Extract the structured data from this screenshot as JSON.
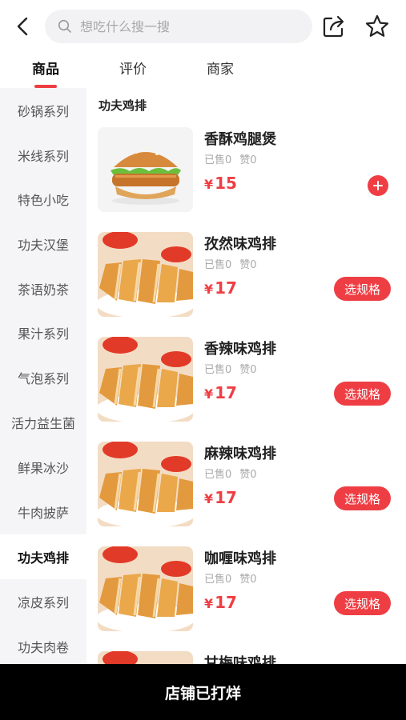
{
  "search": {
    "placeholder": "想吃什么搜一搜"
  },
  "tabs": [
    {
      "label": "商品",
      "active": true
    },
    {
      "label": "评价",
      "active": false
    },
    {
      "label": "商家",
      "active": false
    }
  ],
  "sidebar": {
    "items": [
      {
        "label": "砂锅系列",
        "active": false
      },
      {
        "label": "米线系列",
        "active": false
      },
      {
        "label": "特色小吃",
        "active": false
      },
      {
        "label": "功夫汉堡",
        "active": false
      },
      {
        "label": "茶语奶茶",
        "active": false
      },
      {
        "label": "果汁系列",
        "active": false
      },
      {
        "label": "气泡系列",
        "active": false
      },
      {
        "label": "活力益生菌",
        "active": false
      },
      {
        "label": "鲜果冰沙",
        "active": false
      },
      {
        "label": "牛肉披萨",
        "active": false
      },
      {
        "label": "功夫鸡排",
        "active": true
      },
      {
        "label": "凉皮系列",
        "active": false
      },
      {
        "label": "功夫肉卷",
        "active": false
      }
    ]
  },
  "main": {
    "section_title": "功夫鸡排",
    "products": [
      {
        "name": "香酥鸡腿煲",
        "sold": "已售0",
        "likes": "赞0",
        "currency": "¥",
        "price": "15",
        "action": "plus",
        "image": "burger"
      },
      {
        "name": "孜然味鸡排",
        "sold": "已售0",
        "likes": "赞0",
        "currency": "¥",
        "price": "17",
        "action": "选规格",
        "image": "chicken-cutlet"
      },
      {
        "name": "香辣味鸡排",
        "sold": "已售0",
        "likes": "赞0",
        "currency": "¥",
        "price": "17",
        "action": "选规格",
        "image": "chicken-cutlet"
      },
      {
        "name": "麻辣味鸡排",
        "sold": "已售0",
        "likes": "赞0",
        "currency": "¥",
        "price": "17",
        "action": "选规格",
        "image": "chicken-cutlet"
      },
      {
        "name": "咖喱味鸡排",
        "sold": "已售0",
        "likes": "赞0",
        "currency": "¥",
        "price": "17",
        "action": "选规格",
        "image": "chicken-cutlet"
      },
      {
        "name": "甘梅味鸡排",
        "sold": "",
        "likes": "",
        "currency": "",
        "price": "",
        "action": "",
        "image": "chicken-cutlet"
      }
    ]
  },
  "footer": {
    "status": "店铺已打烊"
  },
  "colors": {
    "accent": "#ee3e44",
    "sidebar_bg": "#f5f5f7",
    "footer_bg": "#000000"
  }
}
